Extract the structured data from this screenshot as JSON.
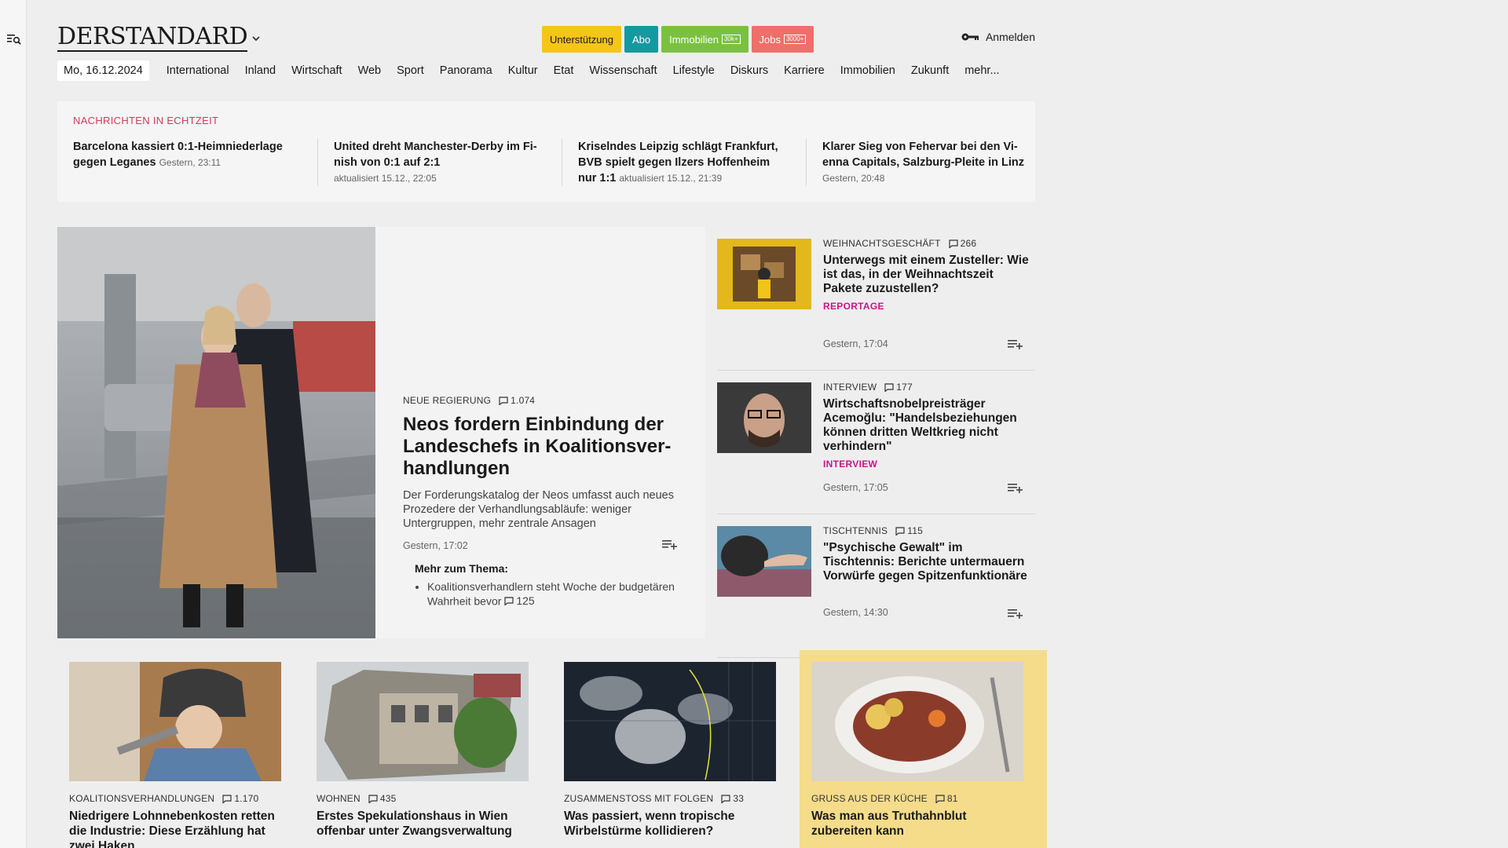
{
  "header": {
    "logo": "DERSTANDARD",
    "pills": {
      "support": "Unterstützung",
      "abo": "Abo",
      "immo": "Immobilien",
      "immo_tag": "30k+",
      "jobs": "Jobs",
      "jobs_tag": "3000+"
    },
    "login": "Anmelden"
  },
  "nav": {
    "date": "Mo, 16.12.2024",
    "items": [
      "International",
      "Inland",
      "Wirtschaft",
      "Web",
      "Sport",
      "Panorama",
      "Kultur",
      "Etat",
      "Wissenschaft",
      "Lifestyle",
      "Diskurs",
      "Karriere",
      "Immobilien",
      "Zukunft",
      "mehr..."
    ]
  },
  "ticker": {
    "label": "NACHRICHTEN IN ECHTZEIT",
    "items": [
      {
        "title": "Barcelona kassiert 0:1-Heimnieder­lage gegen Leganes",
        "meta": "Gestern, 23:11"
      },
      {
        "title": "United dreht Manchester-Derby im Fi­nish von 0:1 auf 2:1",
        "meta": "aktualisiert 15.12., 22:05"
      },
      {
        "title": "Kriselndes Leipzig schlägt Frankfurt, BVB spielt gegen Ilzers Hoffenheim nur 1:1",
        "meta": "aktualisiert 15.12., 21:39"
      },
      {
        "title": "Klarer Sieg von Fehervar bei den Vi­enna Capitals, Salzburg-Pleite in Linz",
        "meta": "Gestern, 20:48"
      }
    ]
  },
  "lead": {
    "kicker": "NEUE REGIERUNG",
    "comments": "1.074",
    "title": "Neos fordern Einbindung der Landeschefs in Koalitionsver­handlungen",
    "teaser": "Der Forderungskatalog der Neos umfasst auch neues Prozedere der Verhandlungsabläufe: weniger Untergruppen, mehr zentrale Ansagen",
    "time": "Gestern, 17:02",
    "more_head": "Mehr zum Thema:",
    "more_item": "Koalitionsverhandlern steht Woche der budgetären Wahrheit bevor",
    "more_comments": "125"
  },
  "side": [
    {
      "kicker": "WEIHNACHTSGESCHÄFT",
      "comments": "266",
      "title": "Unterwegs mit einem Zusteller: Wie ist das, in der Weihnachtszeit Pakete zuzustellen?",
      "genre": "REPORTAGE",
      "time": "Gestern, 17:04"
    },
    {
      "kicker": "INTERVIEW",
      "comments": "177",
      "title": "Wirtschaftsnobelpreisträger Acemoğlu: \"Handelsbeziehungen können dritten Weltkrieg nicht verhindern\"",
      "genre": "INTERVIEW",
      "time": "Gestern, 17:05"
    },
    {
      "kicker": "TISCHTENNIS",
      "comments": "115",
      "title": "\"Psychische Gewalt\" im Tischtennis: Berichte untermauern Vorwürfe gegen Spitzenfunktionäre",
      "time": "Gestern, 14:30"
    }
  ],
  "cards": [
    {
      "kicker": "KOALITIONSVERHANDLUNGEN",
      "comments": "1.170",
      "title": "Niedrigere Lohnnebenkosten retten die Industrie: Diese Erzählung hat zwei Haken"
    },
    {
      "kicker": "WOHNEN",
      "comments": "435",
      "title": "Erstes Spekulationshaus in Wien offenbar unter Zwangsverwaltung"
    },
    {
      "kicker": "ZUSAMMENSTOSS MIT FOLGEN",
      "comments": "33",
      "title": "Was passiert, wenn tropische Wirbelstürme kollidieren?"
    },
    {
      "kicker": "GRUSS AUS DER KÜCHE",
      "comments": "81",
      "title": "Was man aus Truthahnblut zubereiten kann"
    }
  ],
  "colors": {
    "live_label": "#d43a58",
    "genre": "#c9148a",
    "highlight_card": "#f5dc8a"
  }
}
